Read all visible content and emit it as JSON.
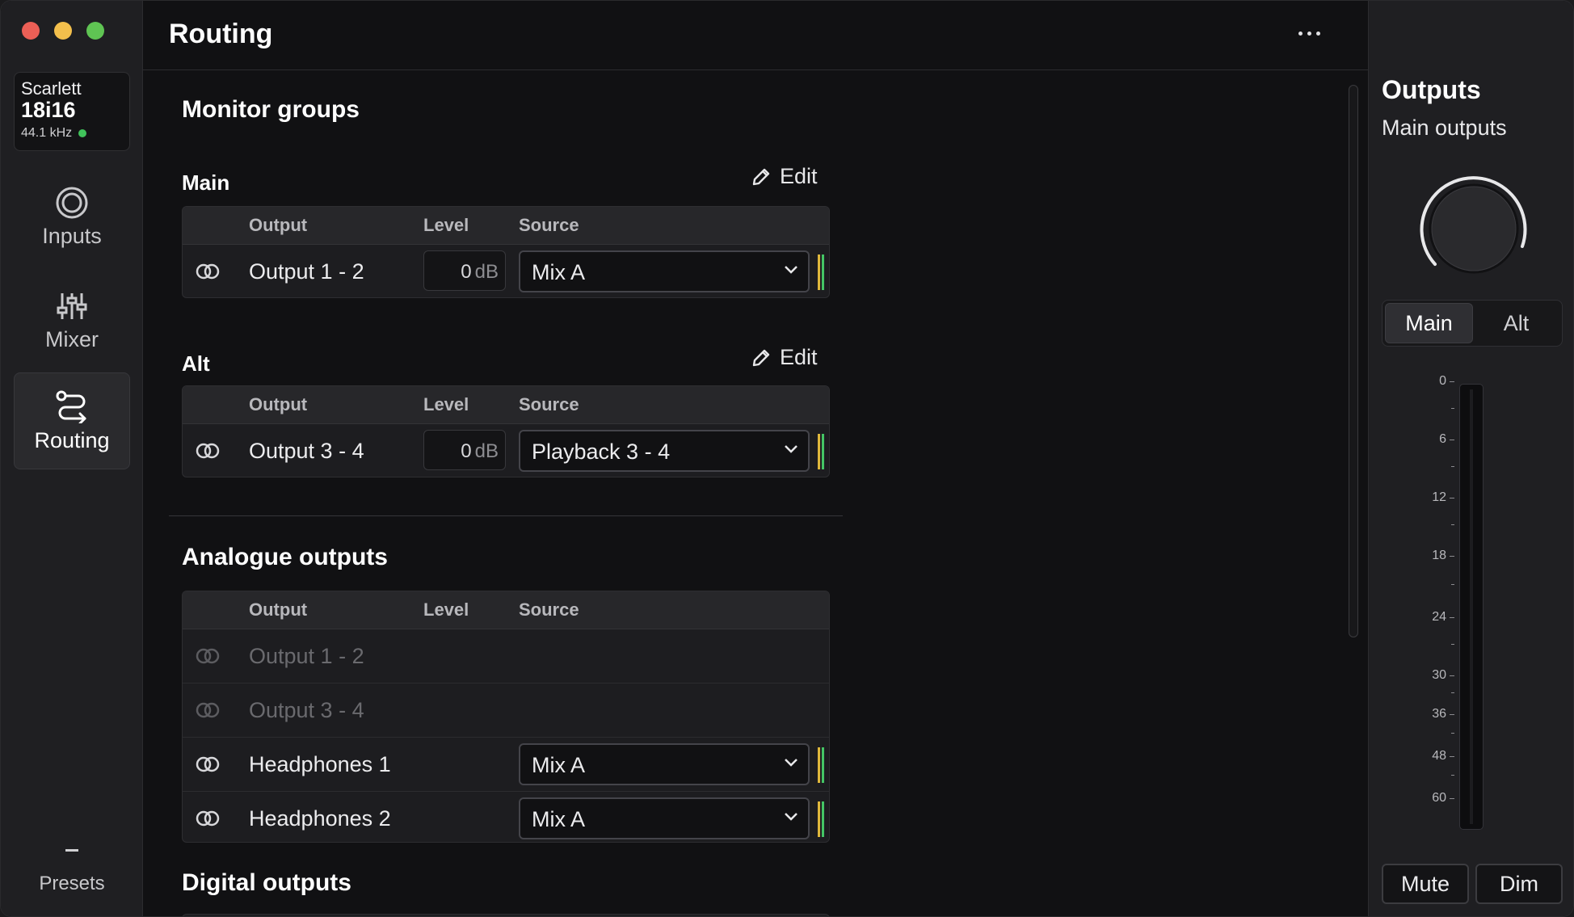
{
  "device": {
    "brand": "Scarlett",
    "model": "18i16",
    "sample_rate": "44.1 kHz"
  },
  "nav": {
    "inputs": "Inputs",
    "mixer": "Mixer",
    "routing": "Routing",
    "presets": "Presets"
  },
  "header": {
    "title": "Routing"
  },
  "monitor_groups": {
    "title": "Monitor groups",
    "edit_label": "Edit",
    "columns": {
      "output": "Output",
      "level": "Level",
      "source": "Source"
    },
    "main": {
      "title": "Main",
      "row": {
        "name": "Output 1 - 2",
        "level": "0",
        "unit": "dB",
        "source": "Mix A"
      }
    },
    "alt": {
      "title": "Alt",
      "row": {
        "name": "Output 3 - 4",
        "level": "0",
        "unit": "dB",
        "source": "Playback 3 - 4"
      }
    }
  },
  "analogue": {
    "title": "Analogue outputs",
    "columns": {
      "output": "Output",
      "level": "Level",
      "source": "Source"
    },
    "rows": [
      {
        "name": "Output 1 - 2"
      },
      {
        "name": "Output 3 - 4"
      },
      {
        "name": "Headphones 1",
        "source": "Mix A"
      },
      {
        "name": "Headphones 2",
        "source": "Mix A"
      }
    ]
  },
  "digital": {
    "title": "Digital outputs"
  },
  "outputs_panel": {
    "title": "Outputs",
    "subtitle": "Main outputs",
    "segment": {
      "main": "Main",
      "alt": "Alt",
      "selected": "Main"
    },
    "scale_labels": [
      "0",
      "6",
      "12",
      "18",
      "24",
      "30",
      "36",
      "48",
      "60"
    ],
    "mute": "Mute",
    "dim": "Dim"
  },
  "colors": {
    "status": "#40c35a",
    "meter_yellow": "#e0b83c",
    "meter_green": "#44c565"
  }
}
